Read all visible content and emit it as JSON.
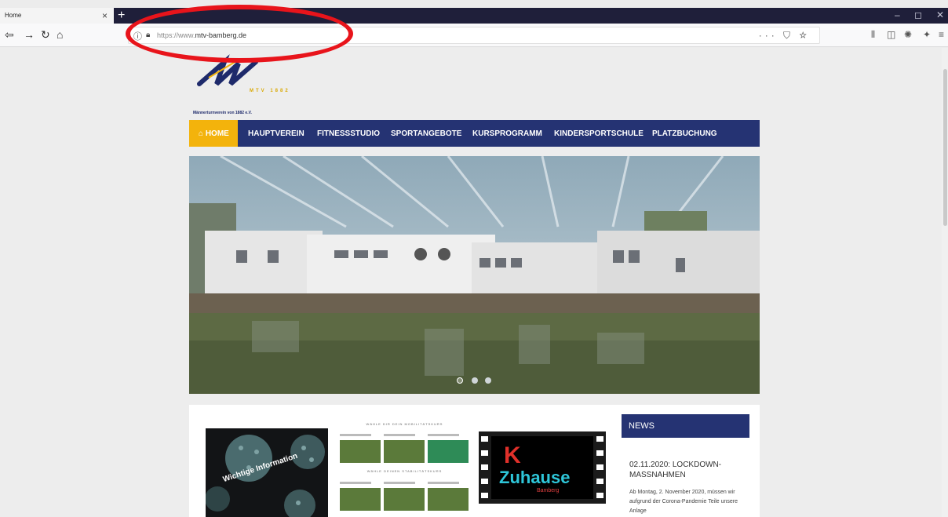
{
  "browser": {
    "tab_title": "Home",
    "tab_close": "×",
    "new_tab": "+",
    "url_prefix": "https://www.",
    "url_domain": "mtv-bamberg.de",
    "page_actions": "··· ⛉ ☆",
    "win_minimize": "–",
    "win_restore": "◻",
    "win_close": "✕"
  },
  "site": {
    "logo_caption": "Männerturnverein von 1882 e.V.",
    "logo_year": "MTV 1882",
    "nav": [
      "HOME",
      "HAUPTVEREIN",
      "FITNESSSTUDIO",
      "SPORTANGEBOTE",
      "KURSPROGRAMM",
      "KINDERSPORTSCHULE",
      "PLATZBUCHUNG"
    ],
    "tile1_text": "Wichtige Information",
    "tile2_heading_1": "WÄHLE DIR DEIN MOBILITÄTSKURS",
    "tile2_heading_2": "WÄHLE DEINEN STABILITÄTSKURS",
    "tile3_k": "K",
    "tile3_text": "Zuhause",
    "tile3_sub": "Bamberg",
    "news_heading": "NEWS",
    "news_title": "02.11.2020: LOCKDOWN-MASSNAHMEN",
    "news_body": "Ab Montag, 2. November 2020, müssen wir aufgrund der Corona-Pandemie Teile unsere Anlage"
  },
  "colors": {
    "nav_bg": "#253373",
    "home_bg": "#f3b30c",
    "annotation_ring": "#e8141b"
  },
  "slider": {
    "count": 3,
    "active_index": 0
  }
}
